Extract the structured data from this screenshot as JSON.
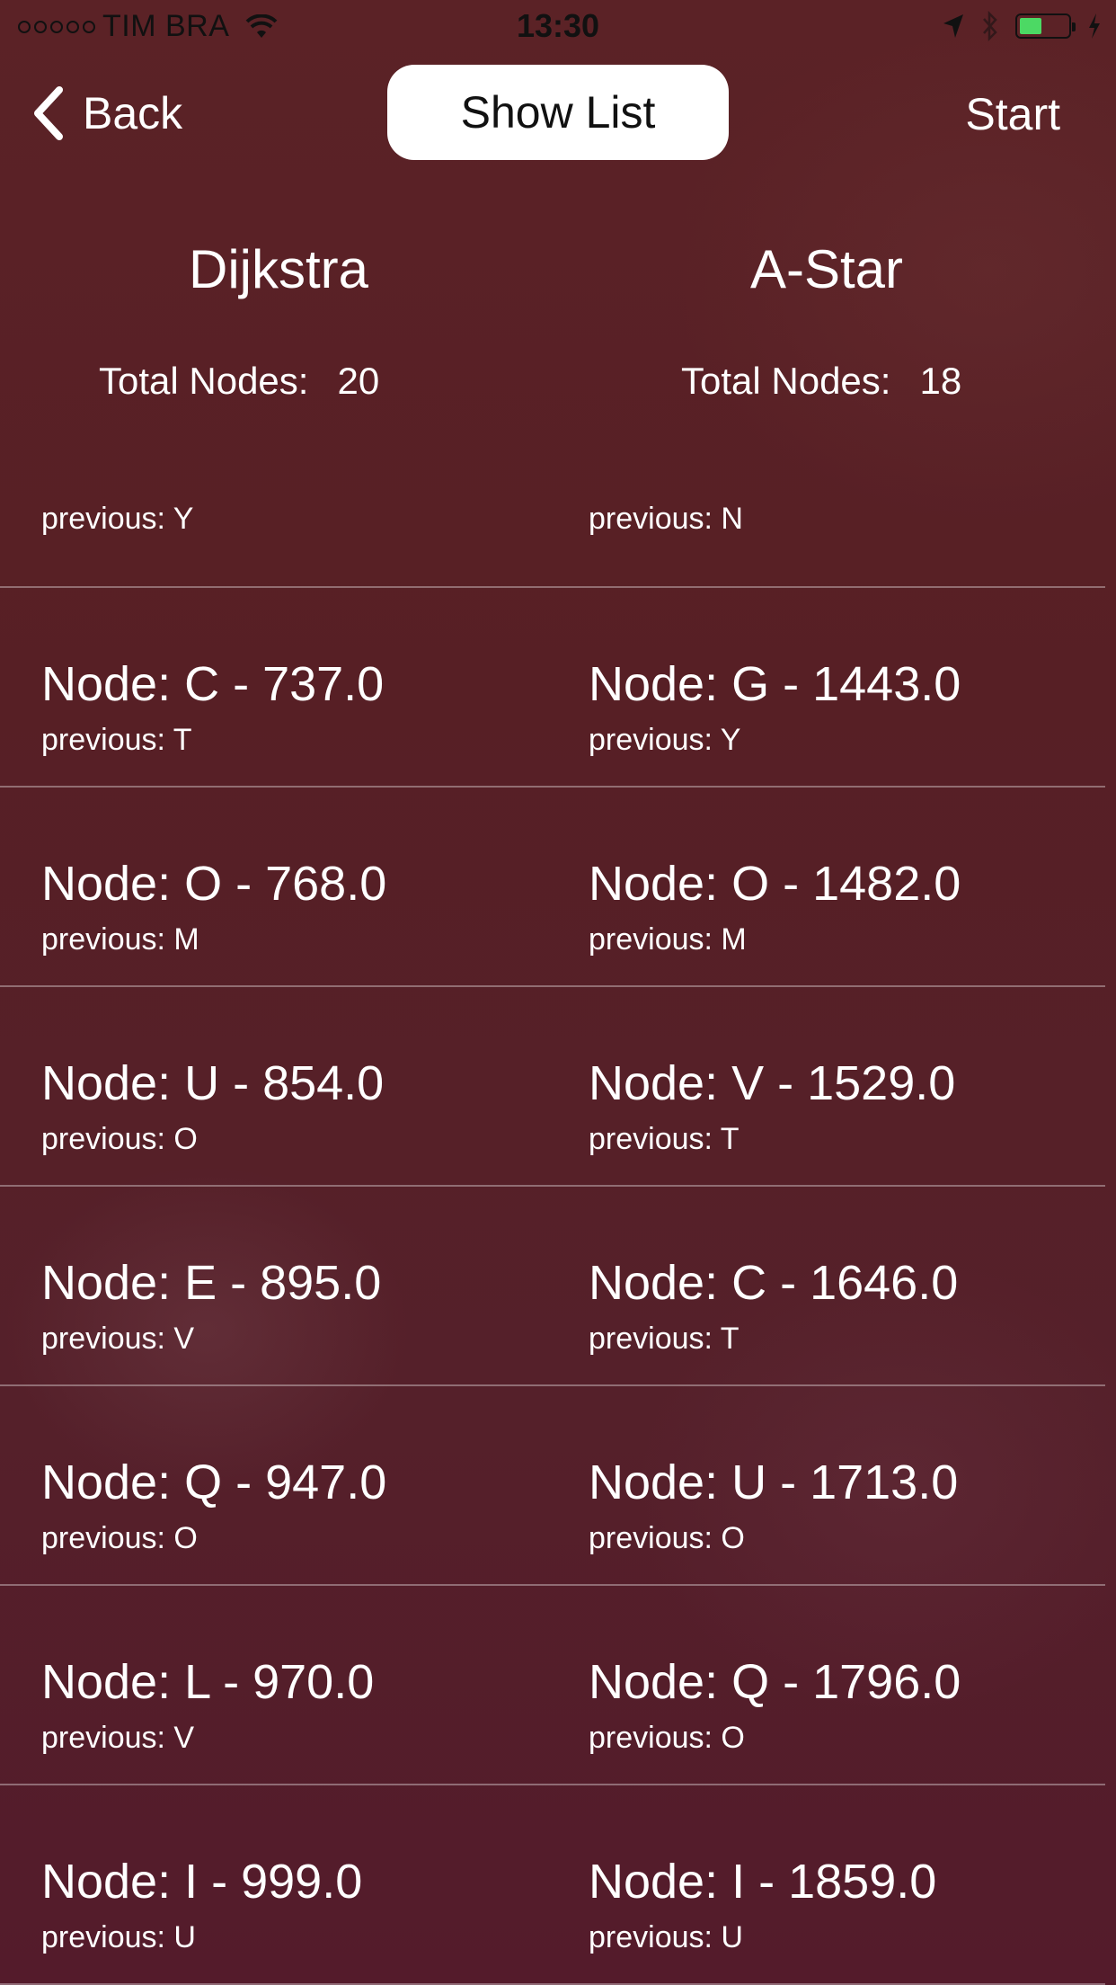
{
  "status_bar": {
    "carrier": "TIM BRA",
    "time": "13:30",
    "battery_color": "#4cd964"
  },
  "nav": {
    "back_label": "Back",
    "center_button_label": "Show List",
    "right_button_label": "Start"
  },
  "columns": {
    "left": {
      "title": "Dijkstra",
      "total_label": "Total Nodes:",
      "total_value": "20"
    },
    "right": {
      "title": "A-Star",
      "total_label": "Total Nodes:",
      "total_value": "18"
    }
  },
  "rows": [
    {
      "left": {
        "node": "",
        "previous": "previous: Y"
      },
      "right": {
        "node": "",
        "previous": "previous: N"
      }
    },
    {
      "left": {
        "node": "Node: C - 737.0",
        "previous": "previous: T"
      },
      "right": {
        "node": "Node: G - 1443.0",
        "previous": "previous: Y"
      }
    },
    {
      "left": {
        "node": "Node: O - 768.0",
        "previous": "previous: M"
      },
      "right": {
        "node": "Node: O - 1482.0",
        "previous": "previous: M"
      }
    },
    {
      "left": {
        "node": "Node: U - 854.0",
        "previous": "previous: O"
      },
      "right": {
        "node": "Node: V - 1529.0",
        "previous": "previous: T"
      }
    },
    {
      "left": {
        "node": "Node: E - 895.0",
        "previous": "previous: V"
      },
      "right": {
        "node": "Node: C - 1646.0",
        "previous": "previous: T"
      }
    },
    {
      "left": {
        "node": "Node: Q - 947.0",
        "previous": "previous: O"
      },
      "right": {
        "node": "Node: U - 1713.0",
        "previous": "previous: O"
      }
    },
    {
      "left": {
        "node": "Node: L - 970.0",
        "previous": "previous: V"
      },
      "right": {
        "node": "Node: Q - 1796.0",
        "previous": "previous: O"
      }
    },
    {
      "left": {
        "node": "Node: I - 999.0",
        "previous": "previous: U"
      },
      "right": {
        "node": "Node: I - 1859.0",
        "previous": "previous: U"
      }
    }
  ]
}
